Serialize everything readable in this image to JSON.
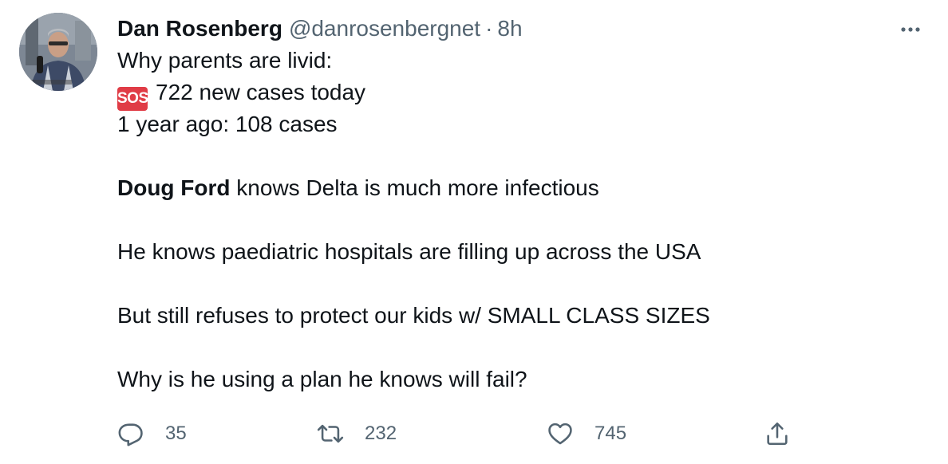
{
  "tweet": {
    "author": {
      "display_name": "Dan Rosenberg",
      "handle": "@danrosenbergnet",
      "separator": "·",
      "time": "8h"
    },
    "lines": {
      "l1": "Why parents are livid:",
      "l2_badge": "SOS",
      "l2": "722 new cases today",
      "l3": "1 year ago: 108 cases",
      "l4_bold": "Doug Ford",
      "l4": " knows Delta is much more infectious",
      "l5": "He knows paediatric hospitals are filling up across the USA",
      "l6": "But still refuses to protect our kids w/ SMALL CLASS SIZES",
      "l7": "Why is he using a plan he knows will fail?"
    },
    "stats": {
      "replies": "35",
      "retweets": "232",
      "likes": "745"
    },
    "icons": {
      "more": "more-icon",
      "reply": "reply-icon",
      "retweet": "retweet-icon",
      "like": "heart-icon",
      "share": "share-icon"
    },
    "colors": {
      "text": "#0f1419",
      "secondary": "#536471",
      "sos_badge": "#e03c46"
    }
  }
}
